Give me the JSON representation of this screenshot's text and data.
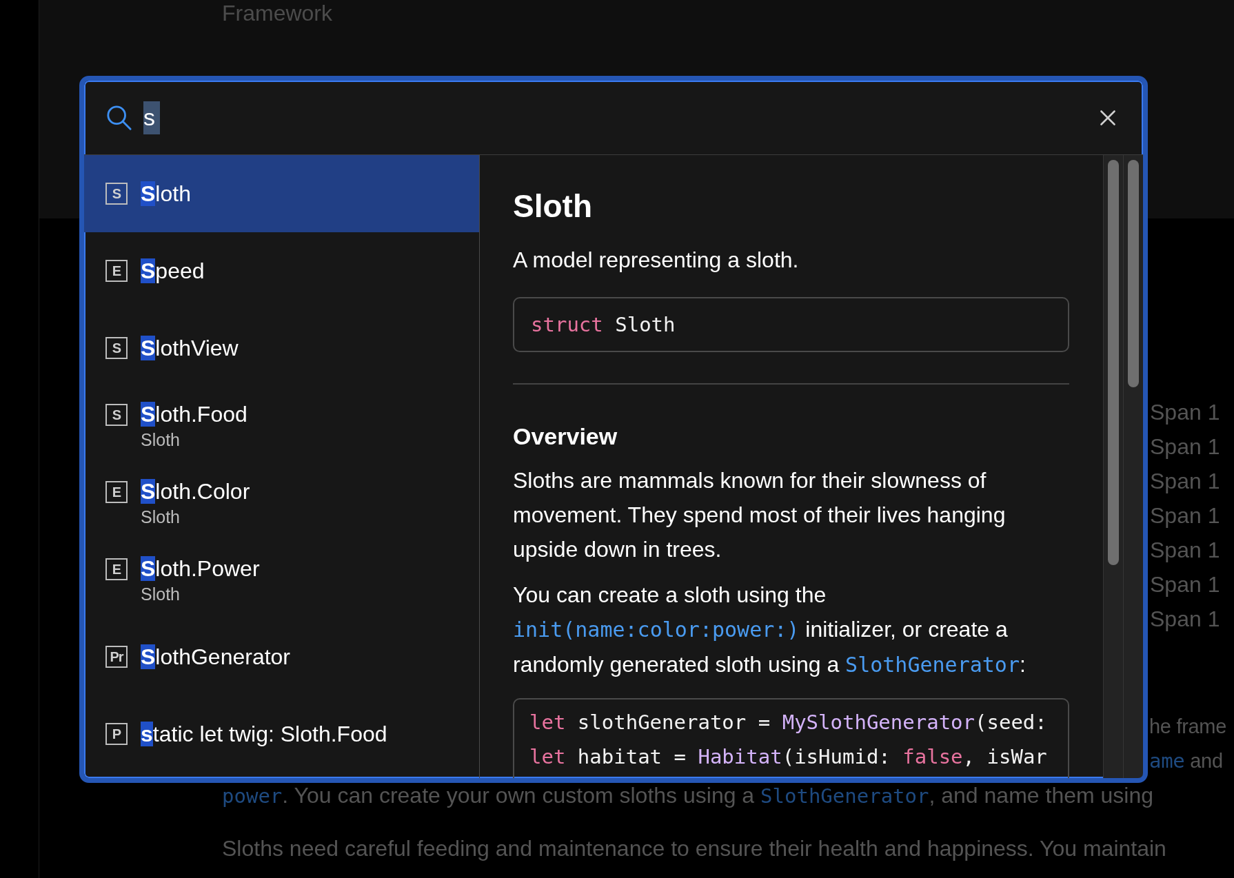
{
  "background": {
    "eyebrow": "Framework",
    "side_labels": [
      "Span 1",
      "Span 1",
      "Span 1",
      "Span 1",
      "Span 1",
      "Span 1",
      "Span 1"
    ],
    "lines": [
      {
        "kind": "tail",
        "runs": [
          {
            "kind": "text",
            "text": "he frame"
          }
        ]
      },
      {
        "kind": "tail",
        "runs": [
          {
            "kind": "code-link",
            "text": "ame"
          },
          {
            "kind": "text",
            "text": " and"
          }
        ]
      },
      {
        "kind": "line",
        "runs": [
          {
            "kind": "code-link",
            "text": "power"
          },
          {
            "kind": "text",
            "text": ". You can create your own custom sloths using a "
          },
          {
            "kind": "code-link",
            "text": "SlothGenerator"
          },
          {
            "kind": "text",
            "text": ", and name them using"
          }
        ]
      },
      {
        "kind": "para",
        "runs": [
          {
            "kind": "text",
            "text": "Sloths need careful feeding and maintenance to ensure their health and happiness. You maintain"
          }
        ]
      }
    ]
  },
  "search": {
    "value": "s"
  },
  "results": [
    {
      "badge": "S",
      "match": "S",
      "rest": "loth",
      "selected": true
    },
    {
      "badge": "E",
      "match": "S",
      "rest": "peed",
      "selected": false
    },
    {
      "badge": "S",
      "match": "S",
      "rest": "lothView",
      "selected": false
    },
    {
      "badge": "S",
      "match": "S",
      "rest": "loth.Food",
      "subtitle": "Sloth",
      "selected": false
    },
    {
      "badge": "E",
      "match": "S",
      "rest": "loth.Color",
      "subtitle": "Sloth",
      "selected": false
    },
    {
      "badge": "E",
      "match": "S",
      "rest": "loth.Power",
      "subtitle": "Sloth",
      "selected": false
    },
    {
      "badge": "Pr",
      "match": "S",
      "rest": "lothGenerator",
      "selected": false
    },
    {
      "badge": "P",
      "match": "s",
      "rest": "tatic let twig: Sloth.Food",
      "selected": false
    }
  ],
  "detail": {
    "title": "Sloth",
    "abstract": "A model representing a sloth.",
    "declaration": [
      {
        "kind": "keyword",
        "text": "struct"
      },
      {
        "kind": "plain",
        "text": " Sloth"
      }
    ],
    "section": "Overview",
    "paragraphs": [
      [
        {
          "kind": "text",
          "text": "Sloths are mammals known for their slowness of movement. They spend most of their lives hanging upside down in trees."
        }
      ],
      [
        {
          "kind": "text",
          "text": "You can create a sloth using the "
        },
        {
          "kind": "code-link",
          "text": "init(name:color:power:)"
        },
        {
          "kind": "text",
          "text": " initializer, or create a randomly generated sloth using a "
        },
        {
          "kind": "code-link",
          "text": "SlothGenerator"
        },
        {
          "kind": "text",
          "text": ":"
        }
      ]
    ],
    "code": [
      [
        {
          "kind": "keyword",
          "text": "let"
        },
        {
          "kind": "plain",
          "text": " slothGenerator = "
        },
        {
          "kind": "type",
          "text": "MySlothGenerator"
        },
        {
          "kind": "plain",
          "text": "(seed:"
        }
      ],
      [
        {
          "kind": "keyword",
          "text": "let"
        },
        {
          "kind": "plain",
          "text": " habitat = "
        },
        {
          "kind": "type",
          "text": "Habitat"
        },
        {
          "kind": "plain",
          "text": "(isHumid: "
        },
        {
          "kind": "keyword",
          "text": "false"
        },
        {
          "kind": "plain",
          "text": ", isWar"
        }
      ]
    ]
  }
}
